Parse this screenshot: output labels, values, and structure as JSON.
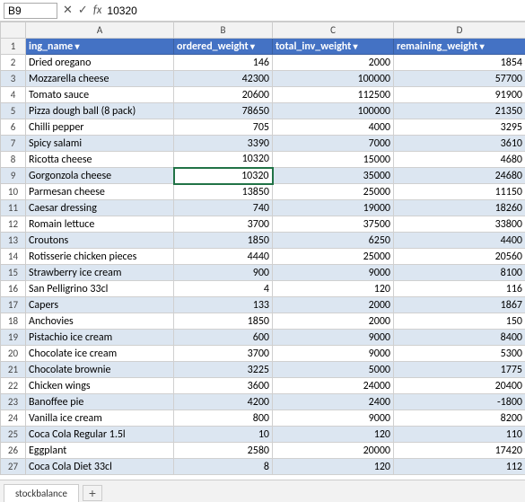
{
  "formulaBar": {
    "cellRef": "B9",
    "formulaValue": "10320",
    "fxLabel": "fx"
  },
  "columns": {
    "headers": [
      "",
      "A",
      "B",
      "C",
      "D"
    ],
    "widths": [
      28,
      165,
      110,
      135,
      147
    ]
  },
  "rows": [
    {
      "rowNum": "1",
      "a": "ing_name",
      "b": "ordered_weight",
      "c": "total_inv_weight",
      "d": "remaining_weight",
      "isHeader": true
    },
    {
      "rowNum": "2",
      "a": "Dried oregano",
      "b": "146",
      "c": "2000",
      "d": "1854"
    },
    {
      "rowNum": "3",
      "a": "Mozzarella cheese",
      "b": "42300",
      "c": "100000",
      "d": "57700"
    },
    {
      "rowNum": "4",
      "a": "Tomato sauce",
      "b": "20600",
      "c": "112500",
      "d": "91900"
    },
    {
      "rowNum": "5",
      "a": "Pizza dough ball (8 pack)",
      "b": "78650",
      "c": "100000",
      "d": "21350"
    },
    {
      "rowNum": "6",
      "a": "Chilli pepper",
      "b": "705",
      "c": "4000",
      "d": "3295"
    },
    {
      "rowNum": "7",
      "a": "Spicy salami",
      "b": "3390",
      "c": "7000",
      "d": "3610"
    },
    {
      "rowNum": "8",
      "a": "Ricotta cheese",
      "b": "10320",
      "c": "15000",
      "d": "4680"
    },
    {
      "rowNum": "9",
      "a": "Gorgonzola cheese",
      "b": "10320",
      "c": "35000",
      "d": "24680",
      "selectedB": true
    },
    {
      "rowNum": "10",
      "a": "Parmesan cheese",
      "b": "13850",
      "c": "25000",
      "d": "11150"
    },
    {
      "rowNum": "11",
      "a": "Caesar dressing",
      "b": "740",
      "c": "19000",
      "d": "18260"
    },
    {
      "rowNum": "12",
      "a": "Romain lettuce",
      "b": "3700",
      "c": "37500",
      "d": "33800"
    },
    {
      "rowNum": "13",
      "a": "Croutons",
      "b": "1850",
      "c": "6250",
      "d": "4400"
    },
    {
      "rowNum": "14",
      "a": "Rotisserie chicken pieces",
      "b": "4440",
      "c": "25000",
      "d": "20560"
    },
    {
      "rowNum": "15",
      "a": "Strawberry ice cream",
      "b": "900",
      "c": "9000",
      "d": "8100"
    },
    {
      "rowNum": "16",
      "a": "San Pelligrino 33cl",
      "b": "4",
      "c": "120",
      "d": "116"
    },
    {
      "rowNum": "17",
      "a": "Capers",
      "b": "133",
      "c": "2000",
      "d": "1867"
    },
    {
      "rowNum": "18",
      "a": "Anchovies",
      "b": "1850",
      "c": "2000",
      "d": "150"
    },
    {
      "rowNum": "19",
      "a": "Pistachio ice cream",
      "b": "600",
      "c": "9000",
      "d": "8400"
    },
    {
      "rowNum": "20",
      "a": "Chocolate ice cream",
      "b": "3700",
      "c": "9000",
      "d": "5300"
    },
    {
      "rowNum": "21",
      "a": "Chocolate brownie",
      "b": "3225",
      "c": "5000",
      "d": "1775"
    },
    {
      "rowNum": "22",
      "a": "Chicken wings",
      "b": "3600",
      "c": "24000",
      "d": "20400"
    },
    {
      "rowNum": "23",
      "a": "Banoffee pie",
      "b": "4200",
      "c": "2400",
      "d": "-1800"
    },
    {
      "rowNum": "24",
      "a": "Vanilla ice cream",
      "b": "800",
      "c": "9000",
      "d": "8200"
    },
    {
      "rowNum": "25",
      "a": "Coca Cola Regular 1.5l",
      "b": "10",
      "c": "120",
      "d": "110"
    },
    {
      "rowNum": "26",
      "a": "Eggplant",
      "b": "2580",
      "c": "20000",
      "d": "17420"
    },
    {
      "rowNum": "27",
      "a": "Coca Cola Diet 33cl",
      "b": "8",
      "c": "120",
      "d": "112"
    }
  ],
  "sheetTab": {
    "name": "stockbalance",
    "addLabel": "+"
  }
}
